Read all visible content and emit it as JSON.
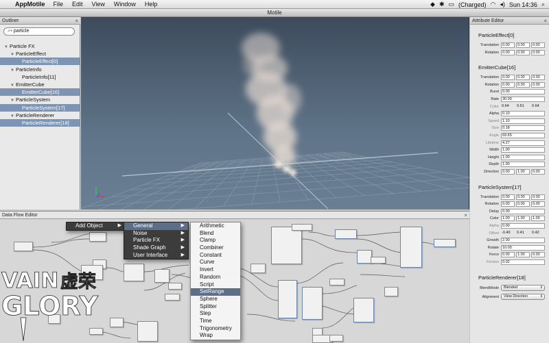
{
  "menubar": {
    "app": "AppMotile",
    "items": [
      "File",
      "Edit",
      "View",
      "Window",
      "Help"
    ],
    "battery": "(Charged)",
    "clock": "Sun 14:36"
  },
  "window_title": "Motile",
  "outliner": {
    "title": "Outliner",
    "search_value": "particle",
    "rows": [
      {
        "label": "Particle FX",
        "indent": 0,
        "expandable": true,
        "selected": false
      },
      {
        "label": "ParticleEffect",
        "indent": 1,
        "expandable": true,
        "selected": false
      },
      {
        "label": "ParticleEffect[0]",
        "indent": 2,
        "expandable": false,
        "selected": true
      },
      {
        "label": "ParticleInfo",
        "indent": 1,
        "expandable": true,
        "selected": false
      },
      {
        "label": "ParticleInfo[11]",
        "indent": 2,
        "expandable": false,
        "selected": false
      },
      {
        "label": "EmitterCube",
        "indent": 1,
        "expandable": true,
        "selected": false
      },
      {
        "label": "EmitterCube[16]",
        "indent": 2,
        "expandable": false,
        "selected": true
      },
      {
        "label": "ParticleSystem",
        "indent": 1,
        "expandable": true,
        "selected": false
      },
      {
        "label": "ParticleSystem[17]",
        "indent": 2,
        "expandable": false,
        "selected": true
      },
      {
        "label": "ParticleRenderer",
        "indent": 1,
        "expandable": true,
        "selected": false
      },
      {
        "label": "ParticleRenderer[18]",
        "indent": 2,
        "expandable": false,
        "selected": true
      }
    ]
  },
  "attribute_editor": {
    "title": "Attribute Editor",
    "sections": [
      {
        "title": "ParticleEffect[0]",
        "fields": [
          {
            "label": "Translation",
            "values": [
              "0.00",
              "0.00",
              "0.00"
            ]
          },
          {
            "label": "Rotation",
            "values": [
              "0.00",
              "0.00",
              "0.00"
            ]
          }
        ]
      },
      {
        "title": "EmitterCube[16]",
        "fields": [
          {
            "label": "Translation",
            "values": [
              "0.00",
              "0.00",
              "0.00"
            ]
          },
          {
            "label": "Rotation",
            "values": [
              "0.00",
              "0.00",
              "0.00"
            ]
          },
          {
            "label": "Burst",
            "values": [
              "0.00"
            ]
          },
          {
            "label": "Rate",
            "values": [
              "30.00"
            ]
          },
          {
            "label": "Color",
            "values": [
              "0.64",
              "0.61",
              "0.64"
            ],
            "dim": true,
            "plain": true
          },
          {
            "label": "Alpha",
            "values": [
              "0.10"
            ]
          },
          {
            "label": "Speed",
            "values": [
              "1.10"
            ],
            "dim": true
          },
          {
            "label": "Size",
            "values": [
              "0.18"
            ],
            "dim": true
          },
          {
            "label": "Angle",
            "values": [
              "69.65"
            ],
            "dim": true
          },
          {
            "label": "Lifetime",
            "values": [
              "4.27"
            ],
            "dim": true
          },
          {
            "label": "Width",
            "values": [
              "1.00"
            ]
          },
          {
            "label": "Height",
            "values": [
              "1.00"
            ]
          },
          {
            "label": "Depth",
            "values": [
              "1.00"
            ]
          },
          {
            "label": "Direction",
            "values": [
              "0.00",
              "1.00",
              "0.00"
            ]
          }
        ]
      },
      {
        "title": "ParticleSystem[17]",
        "fields": [
          {
            "label": "Translation",
            "values": [
              "0.00",
              "0.00",
              "0.00"
            ]
          },
          {
            "label": "Rotation",
            "values": [
              "0.00",
              "0.00",
              "0.00"
            ]
          },
          {
            "label": "Delay",
            "values": [
              "0.00"
            ]
          },
          {
            "label": "Color",
            "values": [
              "1.00",
              "1.00",
              "1.00"
            ]
          },
          {
            "label": "Alpha",
            "values": [
              "0.00"
            ],
            "dim": true
          },
          {
            "label": "Offset",
            "values": [
              "-0.40",
              "0.41",
              "0.42"
            ],
            "dim": true,
            "plain": true
          },
          {
            "label": "Growth",
            "values": [
              "2.00"
            ]
          },
          {
            "label": "Rotate",
            "values": [
              "10.00"
            ]
          },
          {
            "label": "Force",
            "values": [
              "0.00",
              "1.00",
              "0.00"
            ]
          },
          {
            "label": "Friction",
            "values": [
              "0.02"
            ],
            "dim": true
          }
        ]
      },
      {
        "title": "ParticleRenderer[18]",
        "dropdowns": [
          {
            "label": "BlendMode",
            "value": "Blended"
          },
          {
            "label": "Alignment",
            "value": "View Direction"
          }
        ]
      }
    ]
  },
  "data_flow_editor": {
    "title": "Data Flow Editor"
  },
  "context_menu": {
    "level1": [
      {
        "label": "Add Object",
        "sub": true
      }
    ],
    "level2": [
      {
        "label": "General",
        "sub": true
      },
      {
        "label": "Noise",
        "sub": true
      },
      {
        "label": "Particle FX",
        "sub": true
      },
      {
        "label": "Shade Graph",
        "sub": true
      },
      {
        "label": "User Interface",
        "sub": true
      }
    ],
    "level3": [
      "Arithmetic",
      "Blend",
      "Clamp",
      "Combiner",
      "Constant",
      "Curve",
      "Invert",
      "Random",
      "Script",
      "SetRange",
      "Sphere",
      "Splitter",
      "Step",
      "Time",
      "Trigonometry",
      "Wrap"
    ],
    "level3_highlighted": "SetRange"
  },
  "watermark": {
    "line1": "VAIN",
    "line2": "GLORY",
    "cjk": "虚荣"
  },
  "colors": {
    "selection": "#7d95b3",
    "menu_highlight": "#5d6f88",
    "viewport_top": "#3d4b5c"
  }
}
